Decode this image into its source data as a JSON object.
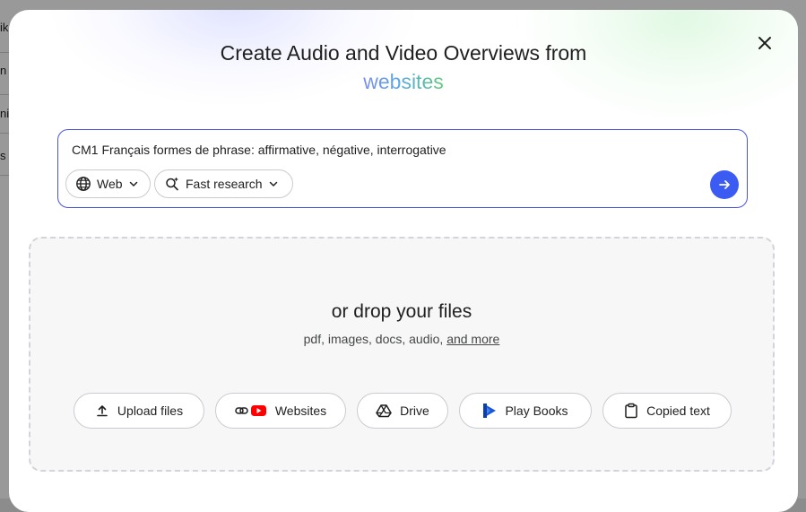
{
  "background_page": {
    "fragments": [
      "ik",
      "n",
      "ni",
      "s"
    ]
  },
  "modal": {
    "title": "Create Audio and Video Overviews from",
    "title_accent": "websites",
    "close_icon": "close-icon"
  },
  "search": {
    "query": "CM1 Français formes de phrase: affirmative, négative, interrogative",
    "source_chip": {
      "label": "Web",
      "icon": "globe-icon"
    },
    "mode_chip": {
      "label": "Fast research",
      "icon": "sparkle-search-icon"
    },
    "submit_icon": "arrow-right-icon"
  },
  "dropzone": {
    "title": "or drop your files",
    "subtitle": "pdf, images, docs, audio,",
    "more_link": "and more",
    "buttons": [
      {
        "label": "Upload files",
        "icon": "upload-icon"
      },
      {
        "label": "Websites",
        "icon": "link-youtube-icon"
      },
      {
        "label": "Drive",
        "icon": "drive-icon"
      },
      {
        "label": "Play Books",
        "icon": "play-books-icon"
      },
      {
        "label": "Copied text",
        "icon": "clipboard-icon"
      }
    ]
  },
  "colors": {
    "accent": "#3b5bf2",
    "search_border": "#4a56d6",
    "youtube_red": "#ff0000",
    "play_books_blue": "#1a57d6"
  }
}
